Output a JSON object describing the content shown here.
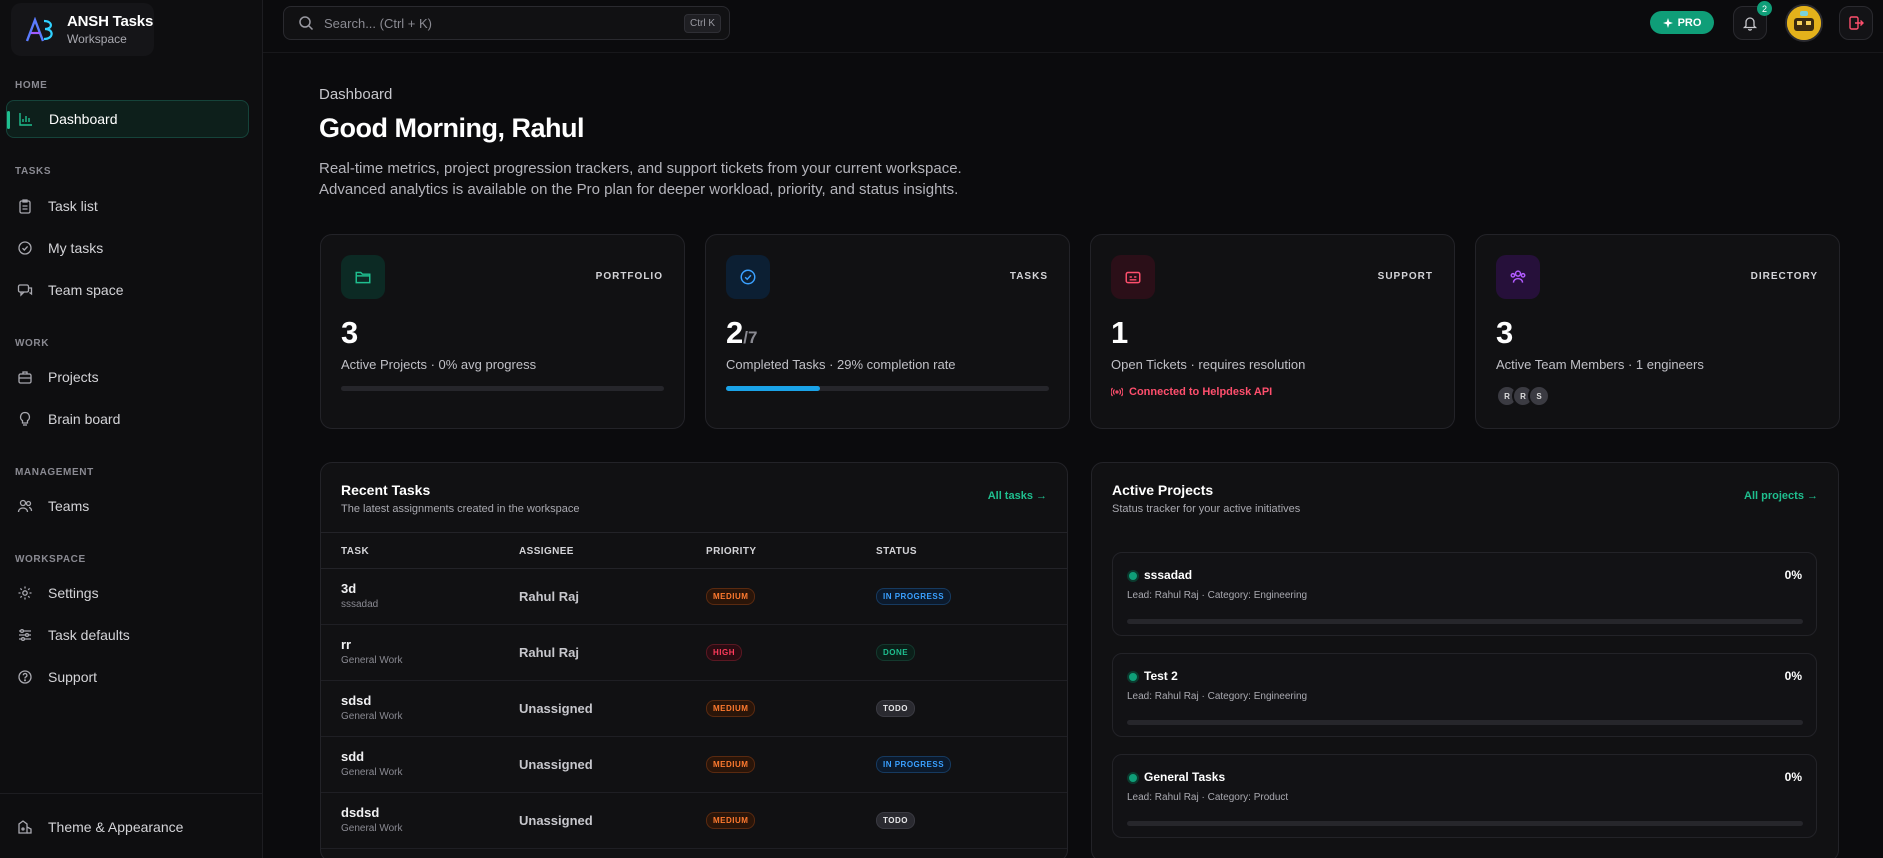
{
  "brand": {
    "name": "ANSH Tasks",
    "sub": "Workspace"
  },
  "sidebar": {
    "sections": [
      "HOME",
      "TASKS",
      "WORK",
      "MANAGEMENT",
      "WORKSPACE"
    ],
    "items": [
      {
        "label": "Dashboard"
      },
      {
        "label": "Task list"
      },
      {
        "label": "My tasks"
      },
      {
        "label": "Team space"
      },
      {
        "label": "Projects"
      },
      {
        "label": "Brain board"
      },
      {
        "label": "Teams"
      },
      {
        "label": "Settings"
      },
      {
        "label": "Task defaults"
      },
      {
        "label": "Support"
      }
    ],
    "footer": "Theme & Appearance"
  },
  "topbar": {
    "search_placeholder": "Search... (Ctrl + K)",
    "shortcut": "Ctrl K",
    "pro": "PRO",
    "notifications": "2"
  },
  "header": {
    "breadcrumb": "Dashboard",
    "title": "Good Morning, Rahul",
    "desc1": "Real-time metrics, project progression trackers, and support tickets from your current workspace.",
    "desc2": "Advanced analytics is available on the Pro plan for deeper workload, priority, and status insights."
  },
  "stats": [
    {
      "label": "PORTFOLIO",
      "value": "3",
      "sub": "Active Projects · 0% avg progress",
      "progress": 0
    },
    {
      "label": "TASKS",
      "value": "2",
      "total": "/7",
      "sub": "Completed Tasks · 29% completion rate",
      "progress": 0.29
    },
    {
      "label": "SUPPORT",
      "value": "1",
      "sub": "Open Tickets · requires resolution",
      "extra": "Connected to Helpdesk API"
    },
    {
      "label": "DIRECTORY",
      "value": "3",
      "sub": "Active Team Members · 1 engineers",
      "members": [
        "R",
        "R",
        "S"
      ]
    }
  ],
  "recent": {
    "title": "Recent Tasks",
    "sub": "The latest assignments created in the workspace",
    "link": "All tasks",
    "columns": [
      "TASK",
      "ASSIGNEE",
      "PRIORITY",
      "STATUS"
    ],
    "rows": [
      {
        "name": "3d",
        "project": "sssadad",
        "assignee": "Rahul Raj",
        "priority": "MEDIUM",
        "status": "IN PROGRESS"
      },
      {
        "name": "rr",
        "project": "General Work",
        "assignee": "Rahul Raj",
        "priority": "HIGH",
        "status": "DONE"
      },
      {
        "name": "sdsd",
        "project": "General Work",
        "assignee": "Unassigned",
        "priority": "MEDIUM",
        "status": "TODO"
      },
      {
        "name": "sdd",
        "project": "General Work",
        "assignee": "Unassigned",
        "priority": "MEDIUM",
        "status": "IN PROGRESS"
      },
      {
        "name": "dsdsd",
        "project": "General Work",
        "assignee": "Unassigned",
        "priority": "MEDIUM",
        "status": "TODO"
      }
    ]
  },
  "projects": {
    "title": "Active Projects",
    "sub": "Status tracker for your active initiatives",
    "link": "All projects",
    "items": [
      {
        "name": "sssadad",
        "meta": "Lead: Rahul Raj · Category: Engineering",
        "pct": "0%"
      },
      {
        "name": "Test 2",
        "meta": "Lead: Rahul Raj · Category: Engineering",
        "pct": "0%"
      },
      {
        "name": "General Tasks",
        "meta": "Lead: Rahul Raj · Category: Product",
        "pct": "0%"
      }
    ]
  },
  "colors": {
    "accent": "#1fbf8f",
    "pro": "#0f9e78",
    "tasks_bar": "#1aa3e8",
    "support": "#ff4f6d"
  }
}
